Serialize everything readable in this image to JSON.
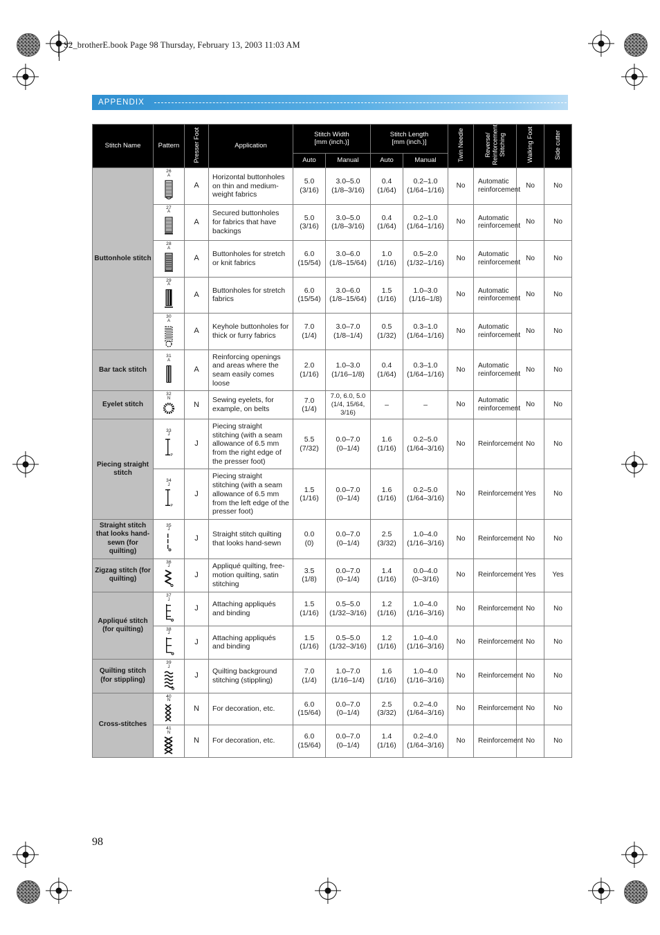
{
  "file_header": "S2_brotherE.book  Page 98  Thursday, February 13, 2003  11:03 AM",
  "banner": {
    "label": "APPENDIX",
    "color": "#3d9ad8"
  },
  "page_number": "98",
  "table": {
    "headers": {
      "stitch_name": "Stitch Name",
      "pattern": "Pattern",
      "presser_foot": "Presser Foot",
      "application": "Application",
      "stitch_width": "Stitch Width\n[mm (inch.)]",
      "stitch_width_line1": "Stitch Width",
      "stitch_width_line2": "[mm (inch.)]",
      "stitch_length_line1": "Stitch Length",
      "stitch_length_line2": "[mm (inch.)]",
      "auto": "Auto",
      "manual": "Manual",
      "twin_needle": "Twin Needle",
      "reverse_reinforcement_line1": "Reverse/",
      "reverse_reinforcement_line2": "Reinforcement",
      "reverse_reinforcement_line3": "Stitching",
      "walking_foot": "Walking Foot",
      "side_cutter": "Side cutter"
    },
    "groups": [
      {
        "name": "Buttonhole stitch",
        "rowspan": 5,
        "rows": [
          {
            "pattern_number": "26",
            "pattern_foot": "A",
            "pattern_icon": "buttonhole-round-end",
            "presser_foot": "A",
            "application": "Horizontal buttonholes on thin and medium-weight fabrics",
            "width_auto": "5.0",
            "width_auto_frac": "(3/16)",
            "width_manual": "3.0–5.0",
            "width_manual_frac": "(1/8–3/16)",
            "length_auto": "0.4",
            "length_auto_frac": "(1/64)",
            "length_manual": "0.2–1.0",
            "length_manual_frac": "(1/64–1/16)",
            "twin_needle": "No",
            "reinforcement": "Automatic reinforcement",
            "walking_foot": "No",
            "side_cutter": "No"
          },
          {
            "pattern_number": "27",
            "pattern_foot": "A",
            "pattern_icon": "buttonhole-square-end",
            "presser_foot": "A",
            "application": "Secured buttonholes for fabrics that have backings",
            "width_auto": "5.0",
            "width_auto_frac": "(3/16)",
            "width_manual": "3.0–5.0",
            "width_manual_frac": "(1/8–3/16)",
            "length_auto": "0.4",
            "length_auto_frac": "(1/64)",
            "length_manual": "0.2–1.0",
            "length_manual_frac": "(1/64–1/16)",
            "twin_needle": "No",
            "reinforcement": "Automatic reinforcement",
            "walking_foot": "No",
            "side_cutter": "No"
          },
          {
            "pattern_number": "28",
            "pattern_foot": "A",
            "pattern_icon": "buttonhole-stretch",
            "presser_foot": "A",
            "application": "Buttonholes for stretch or knit fabrics",
            "width_auto": "6.0",
            "width_auto_frac": "(15/54)",
            "width_manual": "3.0–6.0",
            "width_manual_frac": "(1/8–15/64)",
            "length_auto": "1.0",
            "length_auto_frac": "(1/16)",
            "length_manual": "0.5–2.0",
            "length_manual_frac": "(1/32–1/16)",
            "twin_needle": "No",
            "reinforcement": "Automatic reinforcement",
            "walking_foot": "No",
            "side_cutter": "No"
          },
          {
            "pattern_number": "29",
            "pattern_foot": "A",
            "pattern_icon": "buttonhole-knit",
            "presser_foot": "A",
            "application": "Buttonholes for stretch fabrics",
            "width_auto": "6.0",
            "width_auto_frac": "(15/54)",
            "width_manual": "3.0–6.0",
            "width_manual_frac": "(1/8–15/64)",
            "length_auto": "1.5",
            "length_auto_frac": "(1/16)",
            "length_manual": "1.0–3.0",
            "length_manual_frac": "(1/16–1/8)",
            "twin_needle": "No",
            "reinforcement": "Automatic reinforcement",
            "walking_foot": "No",
            "side_cutter": "No"
          },
          {
            "pattern_number": "30",
            "pattern_foot": "A",
            "pattern_icon": "buttonhole-keyhole",
            "presser_foot": "A",
            "application": "Keyhole buttonholes for thick or furry fabrics",
            "width_auto": "7.0",
            "width_auto_frac": "(1/4)",
            "width_manual": "3.0–7.0",
            "width_manual_frac": "(1/8–1/4)",
            "length_auto": "0.5",
            "length_auto_frac": "(1/32)",
            "length_manual": "0.3–1.0",
            "length_manual_frac": "(1/64–1/16)",
            "twin_needle": "No",
            "reinforcement": "Automatic reinforcement",
            "walking_foot": "No",
            "side_cutter": "No"
          }
        ]
      },
      {
        "name": "Bar tack stitch",
        "rowspan": 1,
        "rows": [
          {
            "pattern_number": "31",
            "pattern_foot": "A",
            "pattern_icon": "bar-tack",
            "presser_foot": "A",
            "application": "Reinforcing openings and areas where the seam easily comes loose",
            "width_auto": "2.0",
            "width_auto_frac": "(1/16)",
            "width_manual": "1.0–3.0",
            "width_manual_frac": "(1/16–1/8)",
            "length_auto": "0.4",
            "length_auto_frac": "(1/64)",
            "length_manual": "0.3–1.0",
            "length_manual_frac": "(1/64–1/16)",
            "twin_needle": "No",
            "reinforcement": "Automatic reinforcement",
            "walking_foot": "No",
            "side_cutter": "No"
          }
        ]
      },
      {
        "name": "Eyelet stitch",
        "rowspan": 1,
        "rows": [
          {
            "pattern_number": "32",
            "pattern_foot": "N",
            "pattern_icon": "eyelet-circle",
            "presser_foot": "N",
            "application": "Sewing eyelets, for example, on belts",
            "width_auto": "7.0",
            "width_auto_frac": "(1/4)",
            "width_manual": "7.0, 6.0, 5.0 (1/4, 15/64, 3/16)",
            "width_manual_frac": "",
            "width_manual_multiline": true,
            "length_auto": "–",
            "length_auto_frac": "",
            "length_manual": "–",
            "length_manual_frac": "",
            "twin_needle": "No",
            "reinforcement": "Automatic reinforcement",
            "walking_foot": "No",
            "side_cutter": "No"
          }
        ]
      },
      {
        "name": "Piecing straight stitch",
        "rowspan": 2,
        "rows": [
          {
            "pattern_number": "33",
            "pattern_foot": "J",
            "pattern_icon": "straight-right-edge",
            "presser_foot": "J",
            "application": "Piecing straight stitching (with a seam allowance of 6.5 mm from the right edge of the presser foot)",
            "width_auto": "5.5",
            "width_auto_frac": "(7/32)",
            "width_manual": "0.0–7.0",
            "width_manual_frac": "(0–1/4)",
            "length_auto": "1.6",
            "length_auto_frac": "(1/16)",
            "length_manual": "0.2–5.0",
            "length_manual_frac": "(1/64–3/16)",
            "twin_needle": "No",
            "reinforcement": "Reinforcement",
            "walking_foot": "No",
            "side_cutter": "No"
          },
          {
            "pattern_number": "34",
            "pattern_foot": "J",
            "pattern_icon": "straight-left-edge",
            "presser_foot": "J",
            "application": "Piecing straight stitching (with a seam allowance of 6.5 mm from the left edge of the presser foot)",
            "width_auto": "1.5",
            "width_auto_frac": "(1/16)",
            "width_manual": "0.0–7.0",
            "width_manual_frac": "(0–1/4)",
            "length_auto": "1.6",
            "length_auto_frac": "(1/16)",
            "length_manual": "0.2–5.0",
            "length_manual_frac": "(1/64–3/16)",
            "twin_needle": "No",
            "reinforcement": "Reinforcement",
            "walking_foot": "Yes",
            "side_cutter": "No"
          }
        ]
      },
      {
        "name": "Straight stitch that looks hand-sewn (for quilting)",
        "rowspan": 1,
        "rows": [
          {
            "pattern_number": "35",
            "pattern_foot": "J",
            "pattern_icon": "hand-sewn-straight",
            "presser_foot": "J",
            "application": "Straight stitch quilting that looks hand-sewn",
            "width_auto": "0.0",
            "width_auto_frac": "(0)",
            "width_manual": "0.0–7.0",
            "width_manual_frac": "(0–1/4)",
            "length_auto": "2.5",
            "length_auto_frac": "(3/32)",
            "length_manual": "1.0–4.0",
            "length_manual_frac": "(1/16–3/16)",
            "twin_needle": "No",
            "reinforcement": "Reinforcement",
            "walking_foot": "No",
            "side_cutter": "No"
          }
        ]
      },
      {
        "name": "Zigzag stitch (for quilting)",
        "rowspan": 1,
        "rows": [
          {
            "pattern_number": "36",
            "pattern_foot": "J",
            "pattern_icon": "zigzag",
            "presser_foot": "J",
            "application": "Appliqué quilting, free-motion quilting, satin stitching",
            "width_auto": "3.5",
            "width_auto_frac": "(1/8)",
            "width_manual": "0.0–7.0",
            "width_manual_frac": "(0–1/4)",
            "length_auto": "1.4",
            "length_auto_frac": "(1/16)",
            "length_manual": "0.0–4.0",
            "length_manual_frac": "(0–3/16)",
            "twin_needle": "No",
            "reinforcement": "Reinforcement",
            "walking_foot": "Yes",
            "side_cutter": "Yes"
          }
        ]
      },
      {
        "name": "Appliqué stitch (for quilting)",
        "rowspan": 2,
        "rows": [
          {
            "pattern_number": "37",
            "pattern_foot": "J",
            "pattern_icon": "applique-blanket",
            "presser_foot": "J",
            "application": "Attaching appliqués and binding",
            "width_auto": "1.5",
            "width_auto_frac": "(1/16)",
            "width_manual": "0.5–5.0",
            "width_manual_frac": "(1/32–3/16)",
            "length_auto": "1.2",
            "length_auto_frac": "(1/16)",
            "length_manual": "1.0–4.0",
            "length_manual_frac": "(1/16–3/16)",
            "twin_needle": "No",
            "reinforcement": "Reinforcement",
            "walking_foot": "No",
            "side_cutter": "No"
          },
          {
            "pattern_number": "38",
            "pattern_foot": "J",
            "pattern_icon": "applique-blanket-wide",
            "presser_foot": "J",
            "application": "Attaching appliqués and binding",
            "width_auto": "1.5",
            "width_auto_frac": "(1/16)",
            "width_manual": "0.5–5.0",
            "width_manual_frac": "(1/32–3/16)",
            "length_auto": "1.2",
            "length_auto_frac": "(1/16)",
            "length_manual": "1.0–4.0",
            "length_manual_frac": "(1/16–3/16)",
            "twin_needle": "No",
            "reinforcement": "Reinforcement",
            "walking_foot": "No",
            "side_cutter": "No"
          }
        ]
      },
      {
        "name": "Quilting stitch (for stippling)",
        "rowspan": 1,
        "rows": [
          {
            "pattern_number": "39",
            "pattern_foot": "J",
            "pattern_icon": "stippling",
            "presser_foot": "J",
            "application": "Quilting background stitching (stippling)",
            "width_auto": "7.0",
            "width_auto_frac": "(1/4)",
            "width_manual": "1.0–7.0",
            "width_manual_frac": "(1/16–1/4)",
            "length_auto": "1.6",
            "length_auto_frac": "(1/16)",
            "length_manual": "1.0–4.0",
            "length_manual_frac": "(1/16–3/16)",
            "twin_needle": "No",
            "reinforcement": "Reinforcement",
            "walking_foot": "No",
            "side_cutter": "No"
          }
        ]
      },
      {
        "name": "Cross-stitches",
        "rowspan": 2,
        "rows": [
          {
            "pattern_number": "40",
            "pattern_foot": "N",
            "pattern_icon": "cross-stitch-single",
            "presser_foot": "N",
            "application": "For decoration, etc.",
            "width_auto": "6.0",
            "width_auto_frac": "(15/64)",
            "width_manual": "0.0–7.0",
            "width_manual_frac": "(0–1/4)",
            "length_auto": "2.5",
            "length_auto_frac": "(3/32)",
            "length_manual": "0.2–4.0",
            "length_manual_frac": "(1/64–3/16)",
            "twin_needle": "No",
            "reinforcement": "Reinforcement",
            "walking_foot": "No",
            "side_cutter": "No"
          },
          {
            "pattern_number": "41",
            "pattern_foot": "N",
            "pattern_icon": "cross-stitch-double",
            "presser_foot": "N",
            "application": "For decoration, etc.",
            "width_auto": "6.0",
            "width_auto_frac": "(15/64)",
            "width_manual": "0.0–7.0",
            "width_manual_frac": "(0–1/4)",
            "length_auto": "1.4",
            "length_auto_frac": "(1/16)",
            "length_manual": "0.2–4.0",
            "length_manual_frac": "(1/64–3/16)",
            "twin_needle": "No",
            "reinforcement": "Reinforcement",
            "walking_foot": "No",
            "side_cutter": "No"
          }
        ]
      }
    ]
  }
}
